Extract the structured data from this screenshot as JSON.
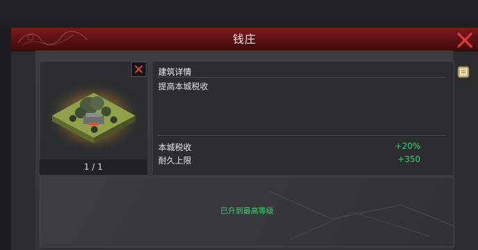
{
  "dialog": {
    "title": "钱庄",
    "close_icon": "close-icon"
  },
  "building": {
    "image_icon": "bank-building-isometric",
    "page_indicator": "1 / 1",
    "dismiss_icon": "close-icon"
  },
  "details": {
    "section_title": "建筑详情",
    "description": "提高本城税收",
    "stats": [
      {
        "label": "本城税收",
        "value": "+20%"
      },
      {
        "label": "耐久上限",
        "value": "+350"
      }
    ]
  },
  "upgrade": {
    "status": "已升到最高等级"
  },
  "side": {
    "icon": "info-scroll-icon"
  },
  "colors": {
    "title_bar": "#5a1012",
    "close_red": "#d23a3a",
    "positive_green": "#3fd07a"
  }
}
